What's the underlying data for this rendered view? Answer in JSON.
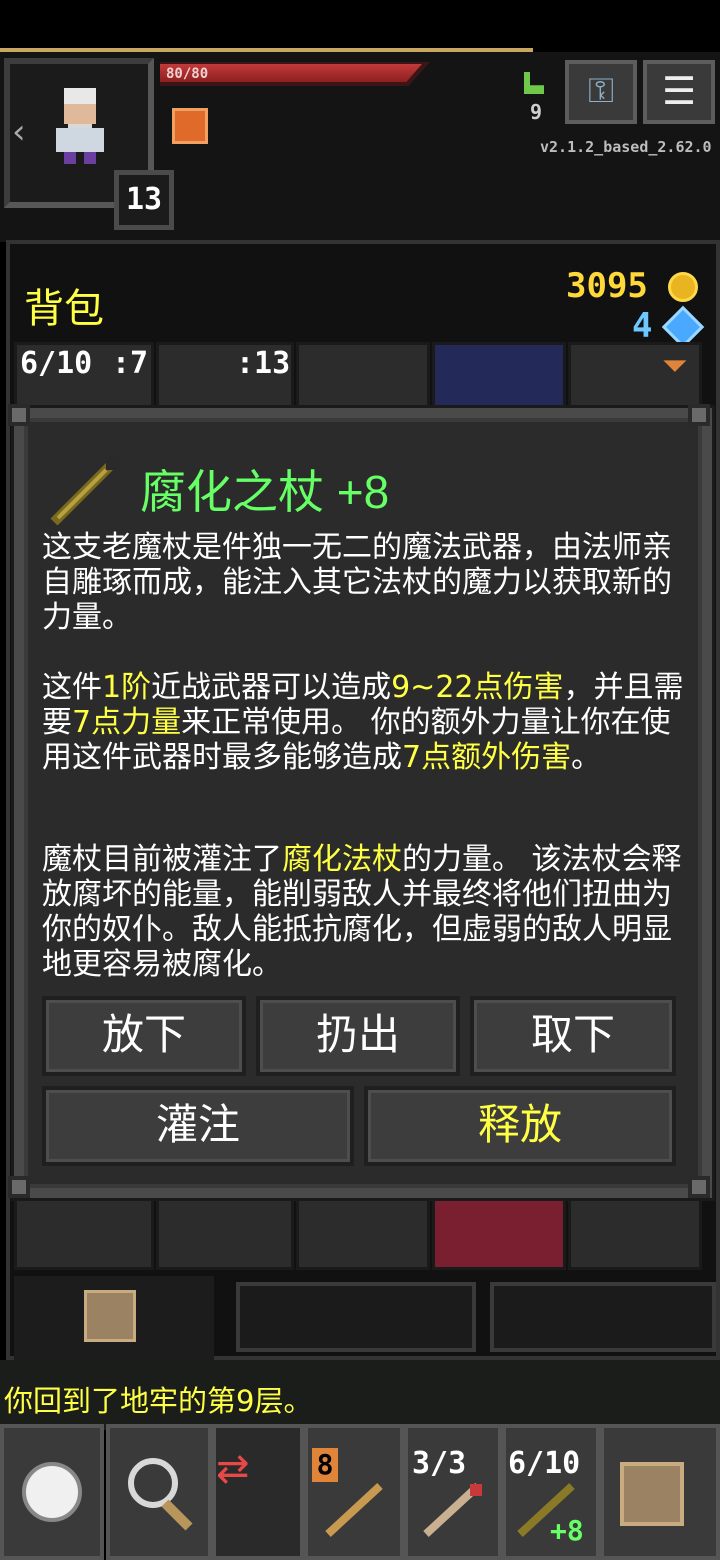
{
  "hud": {
    "hp_text": "80/80",
    "hp_fraction": 1.0,
    "hero_level": "13",
    "depth": "9",
    "version": "v2.1.2_based_2.62.0",
    "xp_fraction": 0.74
  },
  "inventory": {
    "title": "背包",
    "gold": "3095",
    "energy": "4",
    "tabs": [
      {
        "label": "6/10",
        "extra": ":7"
      },
      {
        "label": ":13"
      }
    ]
  },
  "item": {
    "name": "腐化之杖 +8",
    "p1": "这支老魔杖是件独一无二的魔法武器，由法师亲自雕琢而成，能注入其它法杖的魔力以获取新的力量。",
    "p2": {
      "a": "这件",
      "b": "1阶",
      "c": "近战武器可以造成",
      "d": "9~22点伤害",
      "e": "，并且需要",
      "f": "7点力量",
      "g": "来正常使用。 你的额外力量让你在使用这件武器时最多能够造成",
      "h": "7点额外伤害",
      "i": "。"
    },
    "p3": {
      "a": "魔杖目前被灌注了",
      "b": "腐化法杖",
      "c": "的力量。 该法杖会释放腐坏的能量，能削弱敌人并最终将他们扭曲为你的奴仆。敌人能抵抗腐化，但虚弱的敌人明显地更容易被腐化。"
    },
    "buttons": {
      "drop": "放下",
      "throw": "扔出",
      "unequip": "取下",
      "imbue": "灌注",
      "release": "释放"
    }
  },
  "log": "你回到了地牢的第9层。",
  "toolbar": {
    "qs1_badge": "8",
    "qs2_label": "3/3",
    "qs3_label": "6/10",
    "qs3_plus": "+8"
  },
  "colors": {
    "highlight": "#ffff44",
    "item_name": "#66ff66",
    "hp": "#c23a3a"
  }
}
